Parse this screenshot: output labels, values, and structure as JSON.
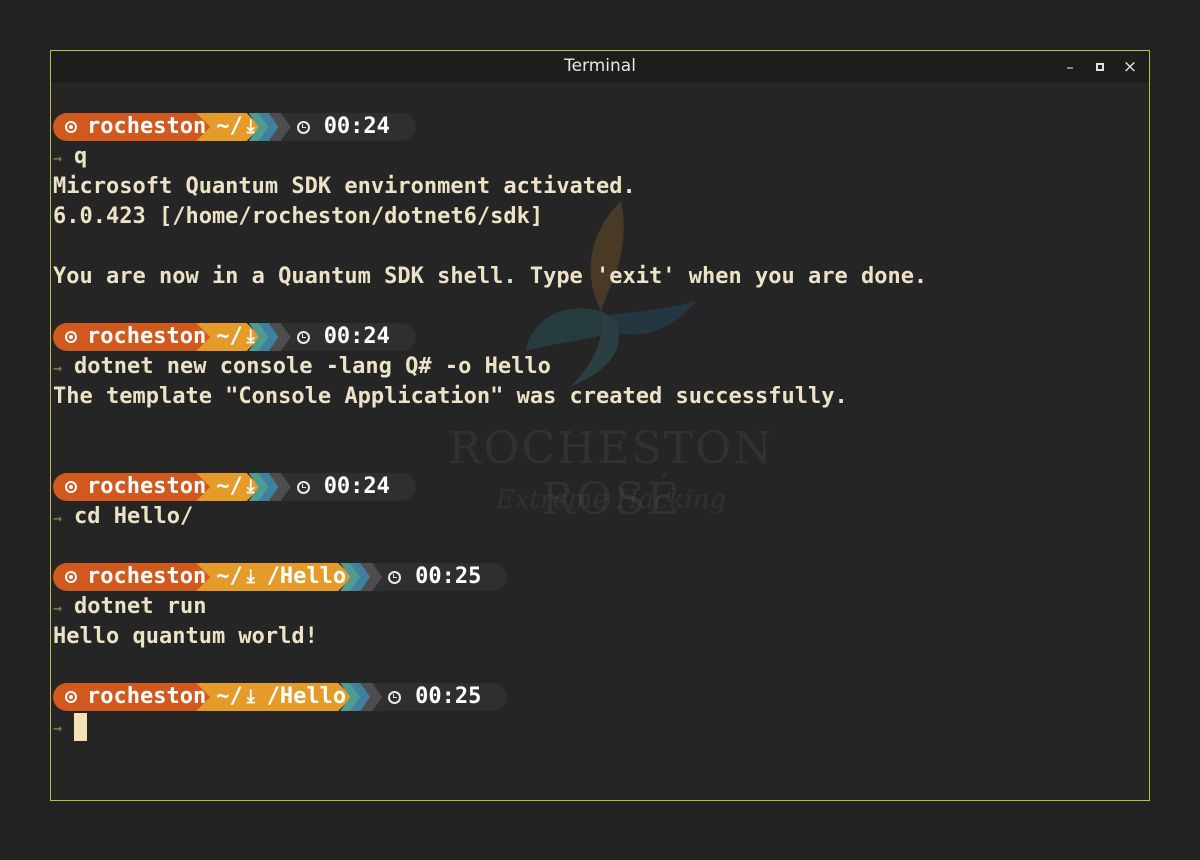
{
  "window": {
    "title": "Terminal",
    "controls": {
      "minimize": "–",
      "close": "×"
    }
  },
  "watermark": {
    "brand": "ROCHESTON ROSÉ",
    "tagline": "Extreme Hacking"
  },
  "prompt_icons": {
    "user": "user-circle-icon",
    "path": "⤓",
    "clock": "clock-icon",
    "command_arrow": "→"
  },
  "colors": {
    "user_segment": "#d2591e",
    "path_segment": "#e49b2a",
    "chevron_teal": "#4f9b8f",
    "chevron_blue": "#3f7fa0",
    "time_segment": "#2f2f2f",
    "window_border": "#b8bf3a",
    "cursor": "#f3e2b6"
  },
  "blocks": [
    {
      "prompt": {
        "user": "rocheston",
        "path": "~/",
        "subdir": "",
        "time": "00:24"
      },
      "command": "q",
      "output": [
        "Microsoft Quantum SDK environment activated.",
        "6.0.423 [/home/rocheston/dotnet6/sdk]",
        "",
        "You are now in a Quantum SDK shell. Type 'exit' when you are done."
      ]
    },
    {
      "prompt": {
        "user": "rocheston",
        "path": "~/",
        "subdir": "",
        "time": "00:24"
      },
      "command": "dotnet new console -lang Q# -o Hello",
      "output": [
        "The template \"Console Application\" was created successfully."
      ]
    },
    {
      "prompt": {
        "user": "rocheston",
        "path": "~/",
        "subdir": "",
        "time": "00:24"
      },
      "command": "cd Hello/",
      "output": []
    },
    {
      "prompt": {
        "user": "rocheston",
        "path": "~/",
        "subdir": "/Hello",
        "time": "00:25"
      },
      "command": "dotnet run",
      "output": [
        "Hello quantum world!"
      ]
    },
    {
      "prompt": {
        "user": "rocheston",
        "path": "~/",
        "subdir": "/Hello",
        "time": "00:25"
      },
      "command": "",
      "output": []
    }
  ]
}
